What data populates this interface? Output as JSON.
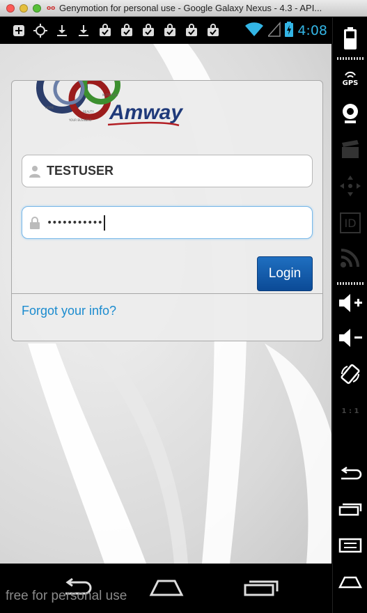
{
  "window": {
    "title": "Genymotion for personal use - Google Galaxy Nexus - 4.3 - API..."
  },
  "statusbar": {
    "time": "4:08",
    "notification_icons": [
      "add-icon",
      "gps-target-icon",
      "download-icon",
      "download-icon",
      "bag-check-icon",
      "bag-check-icon",
      "bag-check-icon",
      "bag-check-icon",
      "bag-check-icon",
      "bag-check-icon"
    ],
    "accent_color": "#33b5e5"
  },
  "login": {
    "brand": "Amway",
    "logo_words": [
      "HOME",
      "BEAUTY",
      "NUTRITION",
      "YOUR BUSINESS"
    ],
    "username": "TESTUSER",
    "password_masked": "•••••••••••",
    "login_label": "Login",
    "forgot_label": "Forgot your info?",
    "link_color": "#1a8bcf",
    "button_color": "#0b4a96"
  },
  "navbar": {
    "watermark": "free for personal use"
  },
  "sidepanel": {
    "gps_label": "GPS",
    "id_label": "ID",
    "scale_label": "1 : 1"
  }
}
